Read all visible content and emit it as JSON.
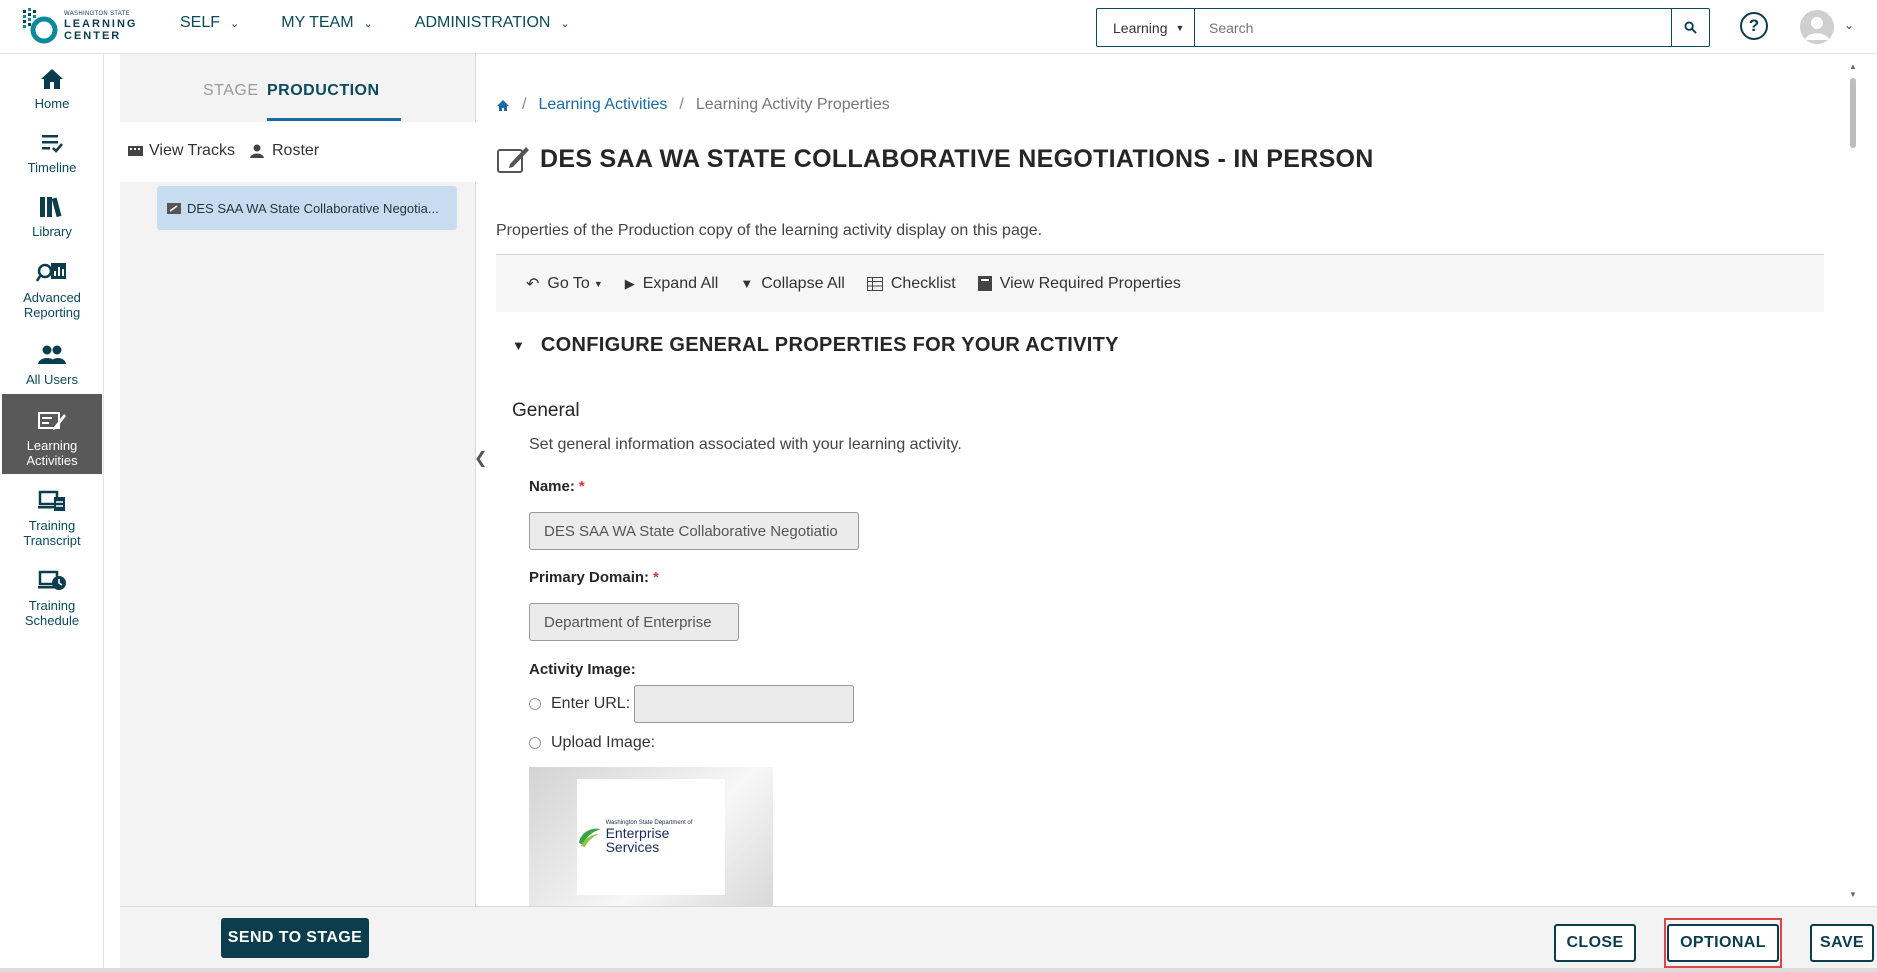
{
  "header": {
    "logo_small": "WASHINGTON STATE",
    "logo_line1": "LEARNING",
    "logo_line2": "CENTER",
    "nav": [
      {
        "label": "SELF"
      },
      {
        "label": "MY TEAM"
      },
      {
        "label": "ADMINISTRATION"
      }
    ],
    "search": {
      "category": "Learning",
      "placeholder": "Search",
      "value": ""
    }
  },
  "rail": {
    "items": [
      {
        "label": "Home",
        "icon": "home-icon"
      },
      {
        "label": "Timeline",
        "icon": "timeline-icon"
      },
      {
        "label": "Library",
        "icon": "library-icon"
      },
      {
        "label": "Advanced Reporting",
        "icon": "reporting-icon"
      },
      {
        "label": "All Users",
        "icon": "users-icon"
      },
      {
        "label": "Learning Activities",
        "icon": "learning-activities-icon",
        "active": true
      },
      {
        "label": "Training Transcript",
        "icon": "transcript-icon"
      },
      {
        "label": "Training Schedule",
        "icon": "schedule-icon"
      }
    ]
  },
  "panel": {
    "tab_stage": "STAGE",
    "tab_production": "PRODUCTION",
    "view_tracks": "View Tracks",
    "roster": "Roster",
    "track_item": "DES SAA WA State Collaborative Negotia..."
  },
  "main": {
    "breadcrumb": {
      "link": "Learning Activities",
      "current": "Learning Activity Properties"
    },
    "title": "DES SAA WA STATE COLLABORATIVE NEGOTIATIONS - IN PERSON",
    "description": "Properties of the Production copy of the learning activity display on this page.",
    "toolbar": {
      "goto": "Go To",
      "expand": "Expand All",
      "collapse": "Collapse All",
      "checklist": "Checklist",
      "required": "View Required Properties"
    },
    "section_title": "CONFIGURE GENERAL PROPERTIES FOR YOUR ACTIVITY",
    "general_heading": "General",
    "general_desc": "Set general information associated with your learning activity.",
    "name_label": "Name:",
    "name_value": "DES SAA WA State Collaborative Negotiatio",
    "domain_label": "Primary Domain:",
    "domain_value": "Department of Enterprise",
    "image_label": "Activity Image:",
    "enter_url_label": "Enter URL:",
    "upload_label": "Upload Image:",
    "required_mark": "*",
    "des_logo_small": "Washington State Department of",
    "des_logo_big": "Enterprise Services"
  },
  "footer": {
    "send_to_stage": "SEND TO STAGE",
    "close": "CLOSE",
    "optional": "OPTIONAL",
    "save": "SAVE"
  },
  "colors": {
    "brand": "#0b3d4c",
    "link": "#1c6aa3",
    "highlight": "#e04545",
    "active_rail": "#595959"
  }
}
